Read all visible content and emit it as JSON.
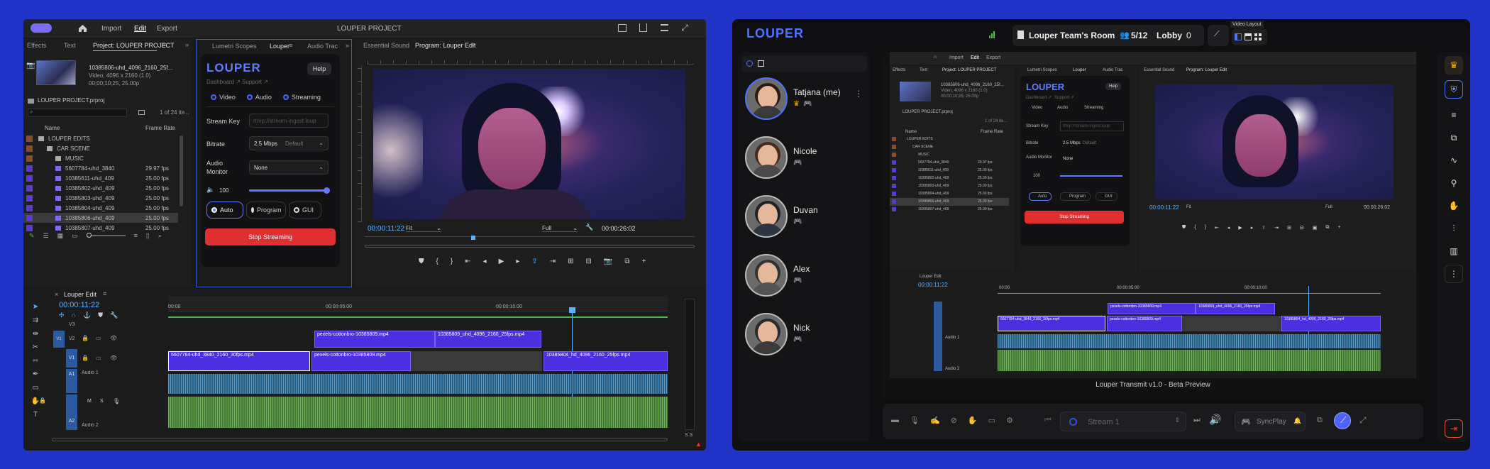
{
  "premiere": {
    "menu": {
      "import": "Import",
      "edit": "Edit",
      "export": "Export",
      "title": "LOUPER PROJECT"
    },
    "project_tabs": [
      "Effects",
      "Text",
      "Project: LOUPER PROJECT"
    ],
    "clip_info": {
      "name": "10385806-uhd_4096_2160_25f...",
      "res": "Video, 4096 x 2160 (1.0)",
      "time": "00;00;10;25, 25.00p"
    },
    "proj_file": "LOUPER PROJECT.prproj",
    "items_count": "1 of 24 ite...",
    "col_name": "Name",
    "col_rate": "Frame Rate",
    "files": [
      {
        "name": "LOUPER EDITS",
        "rate": "",
        "color": "#8b4a2b",
        "indent": 0,
        "folder": true
      },
      {
        "name": "CAR SCENE",
        "rate": "",
        "color": "#8b4a2b",
        "indent": 1,
        "folder": true
      },
      {
        "name": "MUSIC",
        "rate": "",
        "color": "#8b4a2b",
        "indent": 2,
        "folder": true
      },
      {
        "name": "5607784-uhd_3840",
        "rate": "29.97 fps",
        "color": "#5b3ad6",
        "indent": 2,
        "folder": false
      },
      {
        "name": "10385611-uhd_409",
        "rate": "25.00 fps",
        "color": "#5b3ad6",
        "indent": 2,
        "folder": false
      },
      {
        "name": "10385802-uhd_409",
        "rate": "25.00 fps",
        "color": "#5b3ad6",
        "indent": 2,
        "folder": false
      },
      {
        "name": "10385803-uhd_409",
        "rate": "25.00 fps",
        "color": "#5b3ad6",
        "indent": 2,
        "folder": false
      },
      {
        "name": "10385804-uhd_409",
        "rate": "25.00 fps",
        "color": "#5b3ad6",
        "indent": 2,
        "folder": false
      },
      {
        "name": "10385806-uhd_409",
        "rate": "25.00 fps",
        "color": "#5b3ad6",
        "indent": 2,
        "folder": false
      },
      {
        "name": "10385807-uhd_409",
        "rate": "25.00 fps",
        "color": "#5b3ad6",
        "indent": 2,
        "folder": false
      }
    ],
    "plugin_tabs": [
      "Lumetri Scopes",
      "Louper",
      "Audio Trac"
    ],
    "program_tabs": [
      "Essential Sound",
      "Program: Louper Edit"
    ],
    "plugin": {
      "logo": "LOUPER",
      "help": "Help",
      "dashboard": "Dashboard ↗",
      "support": "Support ↗",
      "checks": [
        "Video",
        "Audio",
        "Streaming"
      ],
      "stream_key_label": "Stream Key",
      "stream_key_placeholder": "rtmp://stream-ingest.loup",
      "bitrate_label": "Bitrate",
      "bitrate_value": "2.5 Mbps",
      "bitrate_default": "Default",
      "audio_monitor_label": "Audio Monitor",
      "audio_monitor_value": "None",
      "volume": "100",
      "volume_level": 1.0,
      "modes": [
        "Auto",
        "Program",
        "GUI"
      ],
      "stop": "Stop Streaming"
    },
    "program": {
      "timecode": "00:00:11:22",
      "fit": "Fit",
      "full": "Full",
      "duration": "00:00:26:02"
    },
    "timeline": {
      "tab": "Louper Edit",
      "timecode": "00:00:11:22",
      "ruler": [
        "00:00",
        "00:00:05:00",
        "00:00:10:00"
      ],
      "tracks": [
        "V3",
        "V2",
        "V1",
        "A1",
        "A2"
      ],
      "audio_labels": [
        "Audio 1",
        "Audio 2"
      ],
      "clips_v2": [
        "pexels-cottonbro-10385809.mp4",
        "10385809_uhd_4096_2160_25fps.mp4"
      ],
      "clips_v1": [
        "5607784-uhd_3840_2160_30fps.mp4",
        "pexels-cottonbro-10385809.mp4",
        "10385804_hd_4096_2160_25fps.mp4"
      ],
      "meter": "S S"
    }
  },
  "looper": {
    "logo": "LOUPER",
    "room": "Louper Team's Room",
    "participants": "5/12",
    "lobby": "Lobby",
    "lobby_count": "0",
    "video_layout": "Video Layout",
    "users": [
      {
        "name": "Tatjana (me)",
        "shirt": "#3a3a3a",
        "hair": "#2a1b14"
      },
      {
        "name": "Nicole",
        "shirt": "#4a4a4a",
        "hair": "#4a2a1a"
      },
      {
        "name": "Duvan",
        "shirt": "#2e3540",
        "hair": "#222"
      },
      {
        "name": "Alex",
        "shirt": "#555",
        "hair": "#333"
      },
      {
        "name": "Nick",
        "shirt": "#3b3b3b",
        "hair": "#2b2b2b"
      }
    ],
    "transmit": "Louper Transmit v1.0 - Beta Preview",
    "stream": "Stream 1",
    "syncplay": "SyncPlay"
  }
}
